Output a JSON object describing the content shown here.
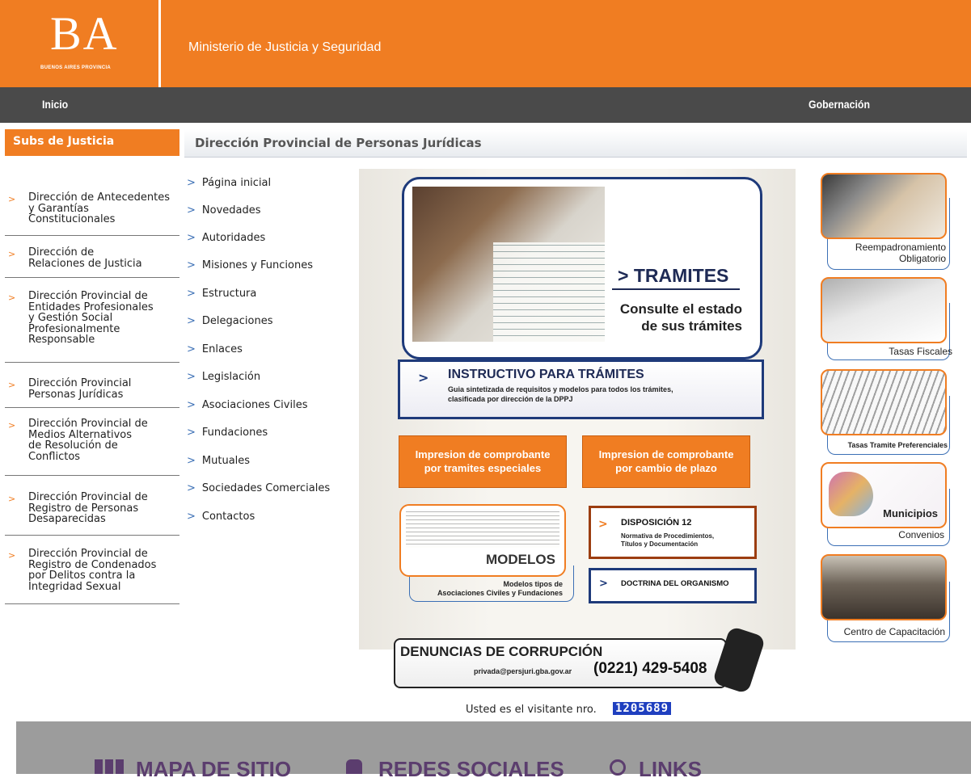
{
  "header": {
    "logo_text": "BA",
    "logo_sub": "BUENOS AIRES PROVINCIA",
    "ministry": "Ministerio de Justicia y Seguridad"
  },
  "nav": {
    "inicio": "Inicio",
    "gobernacion": "Gobernación"
  },
  "sidebar": {
    "title": "Subs de Justicia",
    "items": [
      {
        "label": "Dirección de Antecedentes\ny Garantías\nConstitucionales"
      },
      {
        "label": "Dirección de\nRelaciones de Justicia"
      },
      {
        "label": "Dirección Provincial de\nEntidades Profesionales\ny Gestión Social\nProfesionalmente\nResponsable"
      },
      {
        "label": "Dirección Provincial\nPersonas Jurídicas"
      },
      {
        "label": "Dirección Provincial de\nMedios Alternativos\nde Resolución de\nConflictos"
      },
      {
        "label": "Dirección Provincial de\nRegistro de Personas\nDesaparecidas"
      },
      {
        "label": "Dirección Provincial de\nRegistro de Condenados\npor Delitos contra la\nIntegridad Sexual"
      }
    ]
  },
  "section_title": "Dirección Provincial de Personas Jurídicas",
  "menu": [
    "Página inicial",
    "Novedades",
    "Autoridades",
    "Misiones y Funciones",
    "Estructura",
    "Delegaciones",
    "Enlaces",
    "Legislación",
    "Asociaciones Civiles",
    "Fundaciones",
    "Mutuales",
    "Sociedades Comerciales",
    "Contactos"
  ],
  "tramites": {
    "title": "> TRAMITES",
    "subtitle": "Consulte el estado\nde sus trámites"
  },
  "instructivo": {
    "title": "INSTRUCTIVO PARA TRÁMITES",
    "subtitle": "Guia sintetizada de requisitos y modelos para todos los trámites,\nclasificada por dirección de la DPPJ"
  },
  "buttons": {
    "especiales": "Impresion de comprobante\npor tramites especiales",
    "plazo": "Impresion de comprobante\npor cambio de plazo"
  },
  "modelos": {
    "title": "MODELOS",
    "subtitle": "Modelos tipos de\nAsociaciones Civiles y Fundaciones"
  },
  "disposicion": {
    "title": "DISPOSICIÓN 12",
    "subtitle": "Normativa de Procedimientos,\nTítulos y Documentación"
  },
  "doctrina": "DOCTRINA DEL ORGANISMO",
  "denuncias": {
    "title": "DENUNCIAS DE CORRUPCIÓN",
    "email": "privada@persjuri.gba.gov.ar",
    "phone": "(0221) 429-5408"
  },
  "visitor": {
    "label": "Usted es el visitante nro.",
    "count": "1205689"
  },
  "right_cards": [
    {
      "label": "Reempadronamiento\nObligatorio"
    },
    {
      "label": "Tasas Fiscales"
    },
    {
      "label": "Tasas Tramite Preferenciales"
    },
    {
      "label": "Convenios",
      "overlay": "Municipios"
    },
    {
      "label": "Centro de Capacitación"
    }
  ],
  "footer": {
    "mapa": "MAPA DE SITIO",
    "redes": "REDES SOCIALES",
    "links": "LINKS"
  },
  "colors": {
    "accent": "#f07d22",
    "navbar": "#4a4a4a",
    "navy": "#1e3a7a"
  }
}
